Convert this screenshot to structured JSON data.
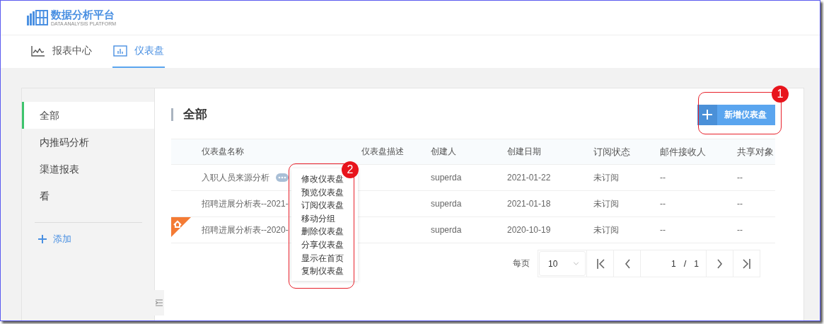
{
  "logo": {
    "title": "数据分析平台",
    "subtitle": "DATA ANALYSIS PLATFORM"
  },
  "nav_tabs": [
    {
      "label": "报表中心",
      "selected": false,
      "kind": "line"
    },
    {
      "label": "仪表盘",
      "selected": true,
      "kind": "bars"
    }
  ],
  "sidebar": {
    "items": [
      {
        "label": "全部",
        "selected": true
      },
      {
        "label": "内推码分析",
        "selected": false
      },
      {
        "label": "渠道报表",
        "selected": false
      },
      {
        "label": "看",
        "selected": false
      }
    ],
    "add_label": "添加"
  },
  "content": {
    "title": "全部",
    "new_button": "新增仪表盘"
  },
  "table": {
    "columns": [
      "仪表盘名称",
      "仪表盘描述",
      "创建人",
      "创建日期",
      "订阅状态",
      "邮件接收人",
      "共享对象"
    ],
    "rows": [
      {
        "flagged": false,
        "more_button": true,
        "name": "入职人员来源分析",
        "creator": "superda",
        "date": "2021-01-22",
        "status": "未订阅",
        "mail": "--",
        "share": "--"
      },
      {
        "flagged": false,
        "more_button": false,
        "name": "招聘进展分析表--2021-",
        "creator": "superda",
        "date": "2021-01-18",
        "status": "未订阅",
        "mail": "--",
        "share": "--"
      },
      {
        "flagged": true,
        "more_button": false,
        "name": "招聘进展分析表--2020-",
        "creator": "superda",
        "date": "2020-10-19",
        "status": "未订阅",
        "mail": "--",
        "share": "--"
      }
    ]
  },
  "context_menu": {
    "items": [
      "修改仪表盘",
      "预览仪表盘",
      "订阅仪表盘",
      "移动分组",
      "删除仪表盘",
      "分享仪表盘",
      "显示在首页",
      "复制仪表盘"
    ]
  },
  "pagination": {
    "label": "每页",
    "page_size": "10",
    "page": "1",
    "separator": "/",
    "total": "1"
  },
  "annotations": [
    {
      "label": "1"
    },
    {
      "label": "2"
    }
  ]
}
